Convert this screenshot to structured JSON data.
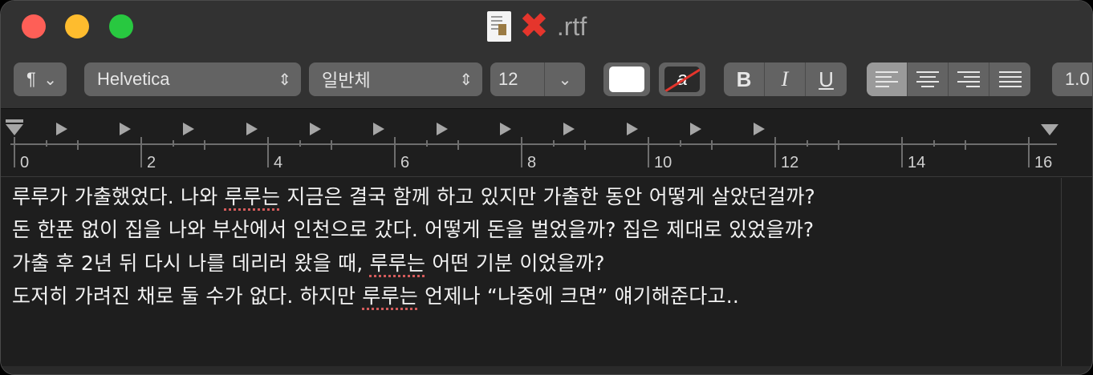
{
  "window": {
    "title": ".rtf",
    "title_icon": "x-mark-icon"
  },
  "toolbar": {
    "paragraph_style": "¶",
    "font_family": "Helvetica",
    "font_style": "일반체",
    "font_size": "12",
    "text_color": "#ffffff",
    "bg_color_letter": "a",
    "bold_label": "B",
    "italic_label": "I",
    "underline_label": "U",
    "line_spacing": "1.0"
  },
  "ruler": {
    "labels": [
      "0",
      "2",
      "4",
      "6",
      "8",
      "10",
      "12",
      "14",
      "16"
    ]
  },
  "document": {
    "lines": [
      {
        "before": "루루가 가출했었다. 나와 ",
        "squiggle": "루루는",
        "after": " 지금은 결국 함께 하고 있지만 가출한 동안 어떻게 살았던걸까?"
      },
      {
        "before": "돈 한푼 없이 집을 나와 부산에서 인천으로 갔다. 어떻게 돈을 벌었을까? 집은 제대로 있었을까?",
        "squiggle": "",
        "after": ""
      },
      {
        "before": "가출 후 2년 뒤 다시 나를 데리러 왔을 때, ",
        "squiggle": "루루는",
        "after": " 어떤 기분 이었을까?"
      },
      {
        "before": "도저히 가려진 채로 둘 수가 없다. 하지만 ",
        "squiggle": "루루는",
        "after": " 언제나 “나중에 크면” 얘기해준다고.."
      }
    ]
  },
  "colors": {
    "close": "#fe5f57",
    "minimize": "#febc2e",
    "maximize": "#28c840",
    "spell_underline": "#d35b5b"
  }
}
